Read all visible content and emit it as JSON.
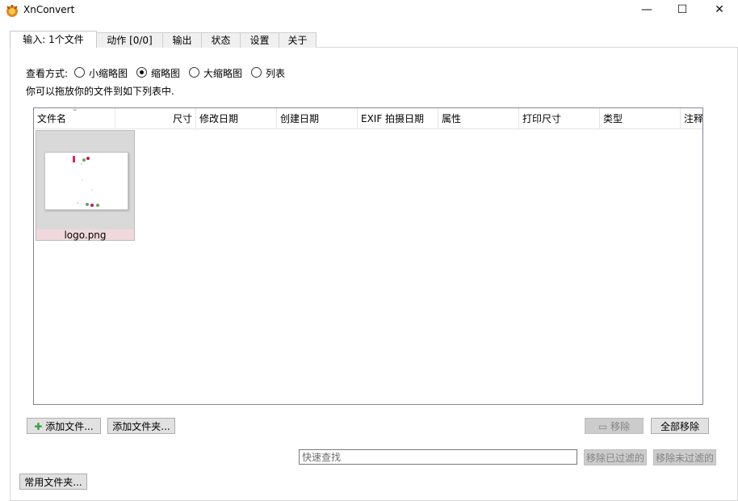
{
  "window": {
    "title": "XnConvert",
    "minimize": "—",
    "maximize": "☐",
    "close": "✕"
  },
  "tabs": [
    {
      "label": "输入:  1个文件"
    },
    {
      "label": "动作 [0/0]"
    },
    {
      "label": "输出"
    },
    {
      "label": "状态"
    },
    {
      "label": "设置"
    },
    {
      "label": "关于"
    }
  ],
  "view_mode": {
    "label": "查看方式:",
    "options": [
      "小缩略图",
      "缩略图",
      "大缩略图",
      "列表"
    ],
    "selected": "缩略图"
  },
  "hint": "你可以拖放你的文件到如下列表中.",
  "columns": [
    "文件名",
    "尺寸",
    "修改日期",
    "创建日期",
    "EXIF 拍摄日期",
    "属性",
    "打印尺寸",
    "类型",
    "注释"
  ],
  "files": [
    {
      "name": "logo.png"
    }
  ],
  "buttons": {
    "add_files": "添加文件...",
    "add_folder": "添加文件夹...",
    "remove": "移除",
    "remove_all": "全部移除",
    "remove_filtered": "移除已过滤的",
    "remove_unfiltered": "移除未过滤的",
    "favorite_folders": "常用文件夹..."
  },
  "search": {
    "placeholder": "快速查找",
    "value": ""
  }
}
